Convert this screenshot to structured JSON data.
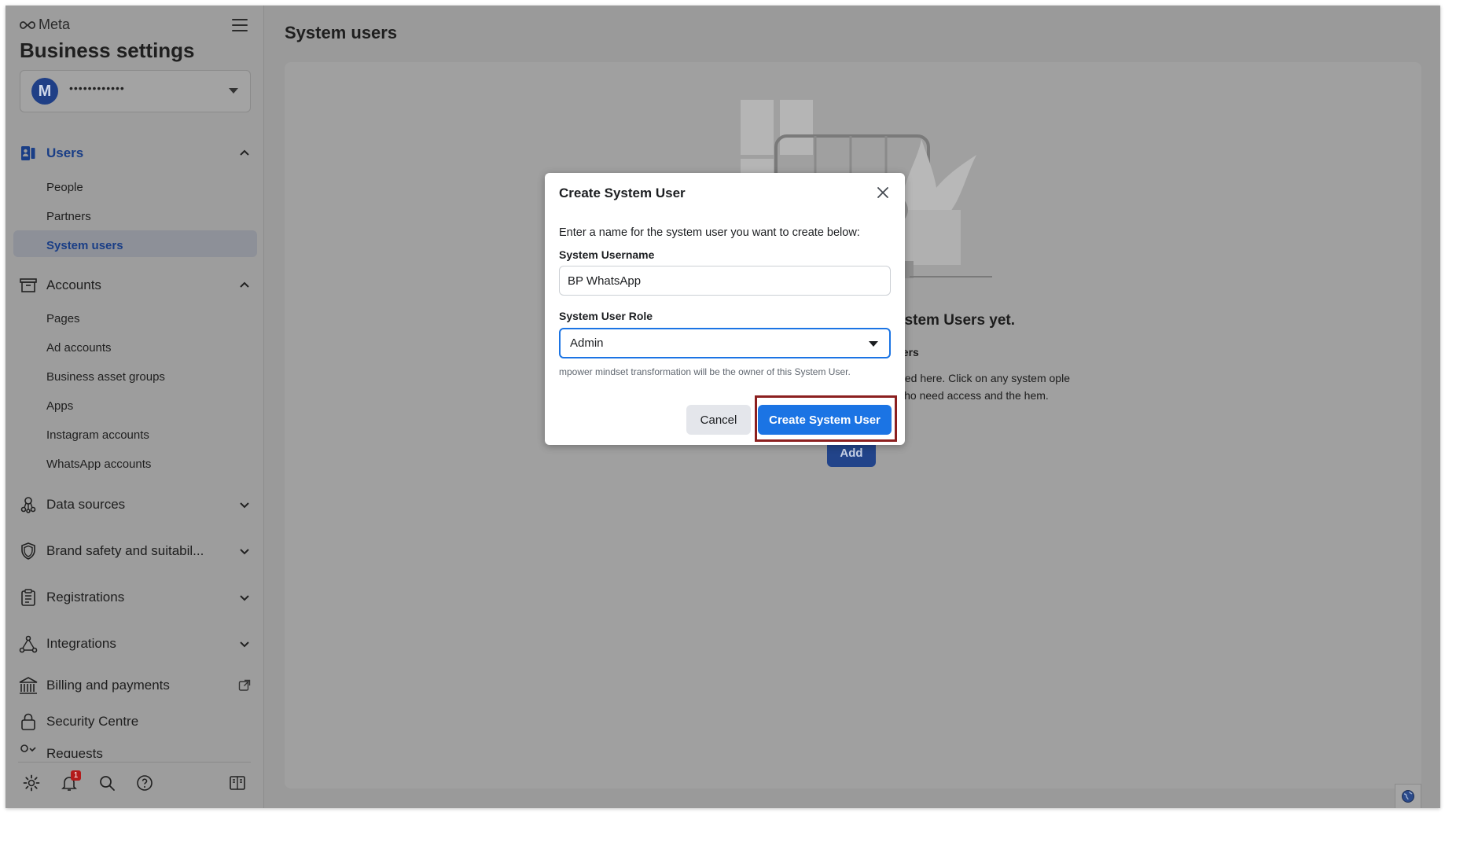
{
  "brand": {
    "logo_text": "Meta"
  },
  "sidebar": {
    "title": "Business settings",
    "account": {
      "avatar_letter": "M",
      "name": "••••••••••••"
    },
    "sections": [
      {
        "label": "Users",
        "icon": "users-icon",
        "expanded": true,
        "active": true,
        "items": [
          {
            "label": "People"
          },
          {
            "label": "Partners"
          },
          {
            "label": "System users",
            "active": true
          }
        ]
      },
      {
        "label": "Accounts",
        "icon": "accounts-icon",
        "expanded": true,
        "items": [
          {
            "label": "Pages"
          },
          {
            "label": "Ad accounts"
          },
          {
            "label": "Business asset groups"
          },
          {
            "label": "Apps"
          },
          {
            "label": "Instagram accounts"
          },
          {
            "label": "WhatsApp accounts"
          }
        ]
      },
      {
        "label": "Data sources",
        "icon": "data-sources-icon"
      },
      {
        "label": "Brand safety and suitabil...",
        "icon": "shield-icon"
      },
      {
        "label": "Registrations",
        "icon": "clipboard-icon"
      },
      {
        "label": "Integrations",
        "icon": "integrations-icon"
      },
      {
        "label": "Billing and payments",
        "icon": "bank-icon",
        "external": true
      },
      {
        "label": "Security Centre",
        "icon": "lock-icon"
      },
      {
        "label": "Requests",
        "icon": "key-icon"
      }
    ],
    "footer": {
      "notification_count": "1"
    }
  },
  "main": {
    "title": "System users",
    "empty_state": {
      "heading": "ystem Users yet.",
      "subheading": "sers",
      "description": "sted here. Click on any system ople who need access and the hem.",
      "add_label": "Add"
    }
  },
  "modal": {
    "title": "Create System User",
    "intro": "Enter a name for the system user you want to create below:",
    "username_label": "System Username",
    "username_value": "BP WhatsApp",
    "role_label": "System User Role",
    "role_value": "Admin",
    "owner_note": "mpower mindset transformation will be the owner of this System User.",
    "cancel_label": "Cancel",
    "create_label": "Create System User"
  },
  "colors": {
    "primary": "#1b74e4",
    "active_nav": "#1a3e86",
    "highlight": "#8b1f1f",
    "badge": "#b31b1b"
  }
}
